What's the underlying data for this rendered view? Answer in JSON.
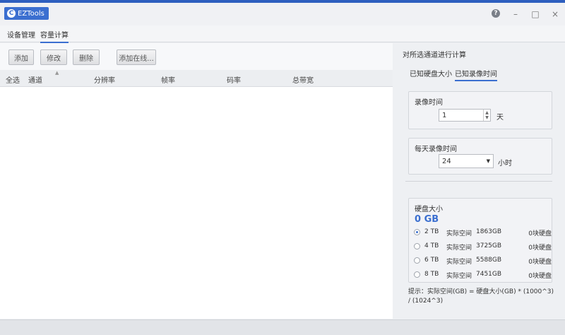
{
  "window": {
    "app_name": "EZTools",
    "logo_char": "C",
    "controls": {
      "help": "?",
      "minimize": "–",
      "maximize": "□",
      "close": "×"
    }
  },
  "main_tabs": {
    "device_management": "设备管理",
    "capacity_calc": "容量计算"
  },
  "toolbar": {
    "add": "添加",
    "modify": "修改",
    "delete": "删除",
    "add_online": "添加在线..."
  },
  "table": {
    "headers": {
      "select_all": "全选",
      "channel": "通道",
      "resolution": "分辨率",
      "frame_rate": "帧率",
      "bitrate": "码率",
      "total_bandwidth": "总带宽"
    },
    "rows": []
  },
  "calc_panel": {
    "title": "对所选通道进行计算",
    "tabs": {
      "known_disk_size": "已知硬盘大小",
      "known_record_time": "已知录像时间"
    },
    "record_time": {
      "label": "录像时间",
      "value": "1",
      "unit": "天"
    },
    "daily_record": {
      "label": "每天录像时间",
      "value": "24",
      "unit": "小时"
    },
    "disk_size": {
      "label": "硬盘大小",
      "result": "0 GB",
      "options": [
        {
          "size": "2 TB",
          "space_label": "实际空间",
          "space": "1863GB",
          "disks": "0块硬盘",
          "selected": true
        },
        {
          "size": "4 TB",
          "space_label": "实际空间",
          "space": "3725GB",
          "disks": "0块硬盘",
          "selected": false
        },
        {
          "size": "6 TB",
          "space_label": "实际空间",
          "space": "5588GB",
          "disks": "0块硬盘",
          "selected": false
        },
        {
          "size": "8 TB",
          "space_label": "实际空间",
          "space": "7451GB",
          "disks": "0块硬盘",
          "selected": false
        }
      ]
    },
    "hint": "提示：实际空间(GB) = 硬盘大小(GB) * (1000^3) / (1024^3)"
  },
  "colors": {
    "accent": "#3b6fd0",
    "title_strip": "#2e5fbf"
  }
}
